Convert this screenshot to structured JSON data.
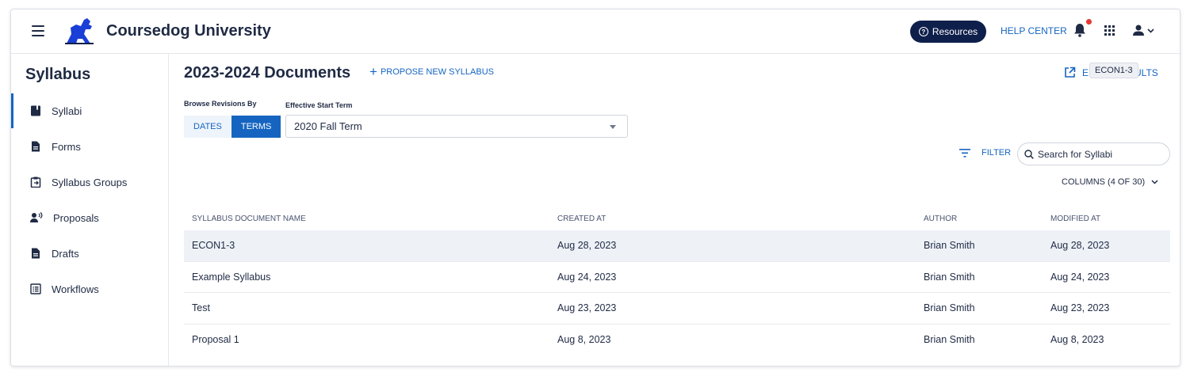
{
  "header": {
    "app_title": "Coursedog University",
    "resources_label": "Resources",
    "help_center_label": "HELP CENTER",
    "accent_color": "#1565c0",
    "notification_dot_color": "#e53935"
  },
  "sidebar": {
    "title": "Syllabus",
    "items": [
      {
        "label": "Syllabi",
        "icon": "book-icon",
        "active": true
      },
      {
        "label": "Forms",
        "icon": "document-icon",
        "active": false
      },
      {
        "label": "Syllabus Groups",
        "icon": "clipboard-icon",
        "active": false
      },
      {
        "label": "Proposals",
        "icon": "person-voice-icon",
        "active": false
      },
      {
        "label": "Drafts",
        "icon": "document-icon",
        "active": false
      },
      {
        "label": "Workflows",
        "icon": "list-icon",
        "active": false
      }
    ]
  },
  "main": {
    "title": "2023-2024 Documents",
    "propose_label": "PROPOSE NEW SYLLABUS",
    "export_label_left": "E",
    "export_label_right": "ULTS",
    "tooltip": "ECON1-3",
    "browse_label": "Browse Revisions By",
    "effective_label": "Effective Start Term",
    "segments": {
      "dates": "DATES",
      "terms": "TERMS",
      "selected": "TERMS"
    },
    "term_value": "2020 Fall Term",
    "filter_label": "FILTER",
    "search_placeholder": "Search for Syllabi",
    "columns_label": "COLUMNS (4 OF 30)"
  },
  "table": {
    "headers": [
      "SYLLABUS DOCUMENT NAME",
      "CREATED AT",
      "AUTHOR",
      "MODIFIED AT"
    ],
    "rows": [
      [
        "ECON1-3",
        "Aug 28, 2023",
        "Brian Smith",
        "Aug 28, 2023"
      ],
      [
        "Example Syllabus",
        "Aug 24, 2023",
        "Brian Smith",
        "Aug 24, 2023"
      ],
      [
        "Test",
        "Aug 23, 2023",
        "Brian Smith",
        "Aug 23, 2023"
      ],
      [
        "Proposal 1",
        "Aug 8, 2023",
        "Brian Smith",
        "Aug 8, 2023"
      ]
    ]
  }
}
